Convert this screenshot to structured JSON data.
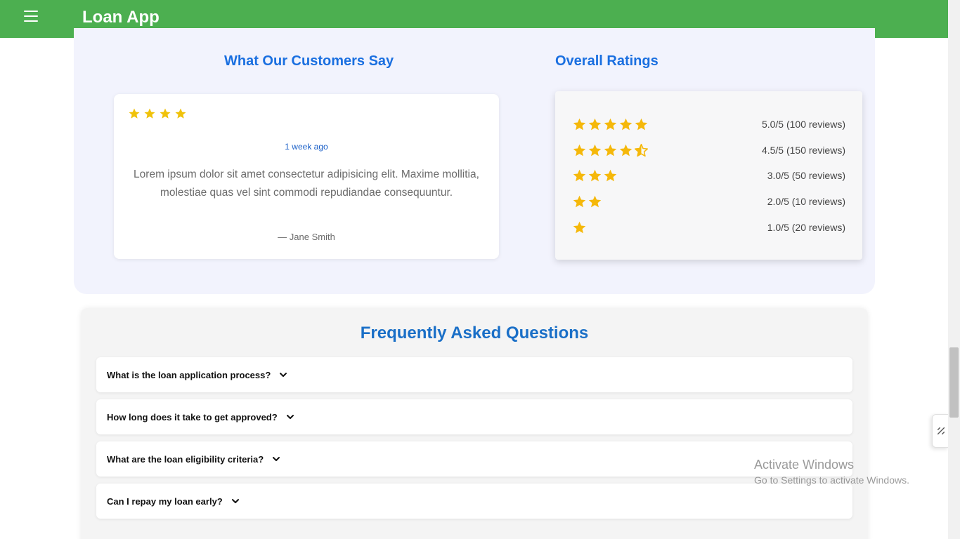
{
  "header": {
    "app_title": "Loan App"
  },
  "testimonials": {
    "heading": "What Our Customers Say",
    "review": {
      "stars": 4,
      "time": "1 week ago",
      "text": "Lorem ipsum dolor sit amet consectetur adipisicing elit. Maxime mollitia, molestiae quas vel sint commodi repudiandae consequuntur.",
      "author": "— Jane Smith"
    }
  },
  "ratings": {
    "heading": "Overall Ratings",
    "rows": [
      {
        "stars": 5,
        "label": "5.0/5 (100 reviews)"
      },
      {
        "stars": 4.5,
        "label": "4.5/5 (150 reviews)"
      },
      {
        "stars": 3,
        "label": "3.0/5 (50 reviews)"
      },
      {
        "stars": 2,
        "label": "2.0/5 (10 reviews)"
      },
      {
        "stars": 1,
        "label": "1.0/5 (20 reviews)"
      }
    ]
  },
  "faq": {
    "heading": "Frequently Asked Questions",
    "items": [
      {
        "question": "What is the loan application process?"
      },
      {
        "question": "How long does it take to get approved?"
      },
      {
        "question": "What are the loan eligibility criteria?"
      },
      {
        "question": "Can I repay my loan early?"
      }
    ]
  },
  "watermark": {
    "title": "Activate Windows",
    "subtitle": "Go to Settings to activate Windows."
  },
  "colors": {
    "header": "#4caf50",
    "heading_blue": "#1a6fe0",
    "star": "#f5b80a",
    "review_star": "#f0c20a"
  }
}
